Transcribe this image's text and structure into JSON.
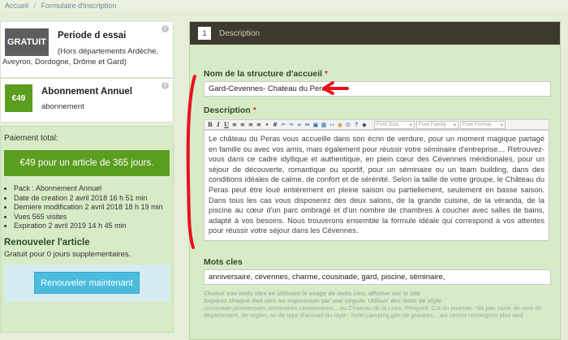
{
  "breadcrumb": {
    "home": "Accueil",
    "separator": "/",
    "current": "Formulaire d'inscription"
  },
  "plans": [
    {
      "badge": "GRATUIT",
      "title": "Periode d essai",
      "description": "(Hors départements Ardèche, Aveyron, Dordogne, Drôme et Gard)",
      "badge_color": "#5d5d5d"
    },
    {
      "badge": "€49",
      "title": "Abonnement Annuel",
      "description": "abonnement",
      "badge_color": "#5b9d1f"
    }
  ],
  "payment": {
    "label": "Paiement total:",
    "button": "€49 pour un article de 365 jours.",
    "details": [
      "Pack : Abonnement Annuel",
      "Date de creation 2 avril 2018 16 h 51 min",
      "Derniere modification 2 avril 2018 18 h 19 min",
      "Vues 565 visites",
      "Expiration 2 avril 2019 14 h 45 min"
    ]
  },
  "renew": {
    "title": "Renouveler l'article",
    "subtitle": "Gratuit pour 0 jours supplementaires.",
    "button": "Renouveler maintenant"
  },
  "form": {
    "step_number": "1",
    "step_title": "Description",
    "structure_label": "Nom de la structure d'accueil",
    "required_mark": "*",
    "structure_value": "Gard-Cevennes- Chateau du Peras",
    "description_label": "Description",
    "toolbar": {
      "font_size": "Font Size",
      "font_family": "Font Family",
      "font_format": "Font Format"
    },
    "description_value": "Le château du Peras vous accueille  dans son écrin de verdure, pour un moment magique partagé en famille ou avec vos amis, mais également pour réussir votre séminaire d'entreprise… Retrouvez-vous dans ce cadre idyllique et authentique, en plein cœur des Cévennes méridionales, pour un séjour de découverte, romantique ou sportif, pour un séminaire ou un team building, dans des conditions idéales de calme, de confort et de sérénité. Selon la taille de votre groupe, le Château du Peras peut être loué entièrement en pleine saison ou partiellement, seulement  en basse saison.  Dans tous les cas vous disposerez  des deux salons, de la grande cuisine, de la véranda, de la piscine au cœur d'un parc ombragé et d'un nombre de chambres à coucher avec salles de bains, adapté à vos besoins. Nous trouverons ensemble la formule idéale qui correspond à vos attentes pour réussir votre séjour dans les Cévennes.",
    "keywords_label": "Mots cles",
    "keywords_value": "anniversaire, cevennes, charme, cousinade, gard, piscine, séminaire,",
    "hint_line1": "Choisir vos mots cles en utilisant le usage de mots cles, afficher sur le site",
    "hint_line2": "Separez chaque mot cles ou expression par une virgule. Utiliser des mots de style",
    "hint_line3": "cousinade,anniversaire,seminaires,randonneurs... ou Chateau de la Loire, Perigord, Col du tourmet.. Ne pas saisir de nom de departement, de region, ou de type d'accueil du style : hotel,camping,gite de groupes... qui seront renseignes plus tard"
  },
  "colors": {
    "accent_green": "#5b9d1f",
    "panel_dark": "#3e3a2f",
    "renew_button": "#4cbcdc",
    "annotation_red": "#e8121c"
  }
}
